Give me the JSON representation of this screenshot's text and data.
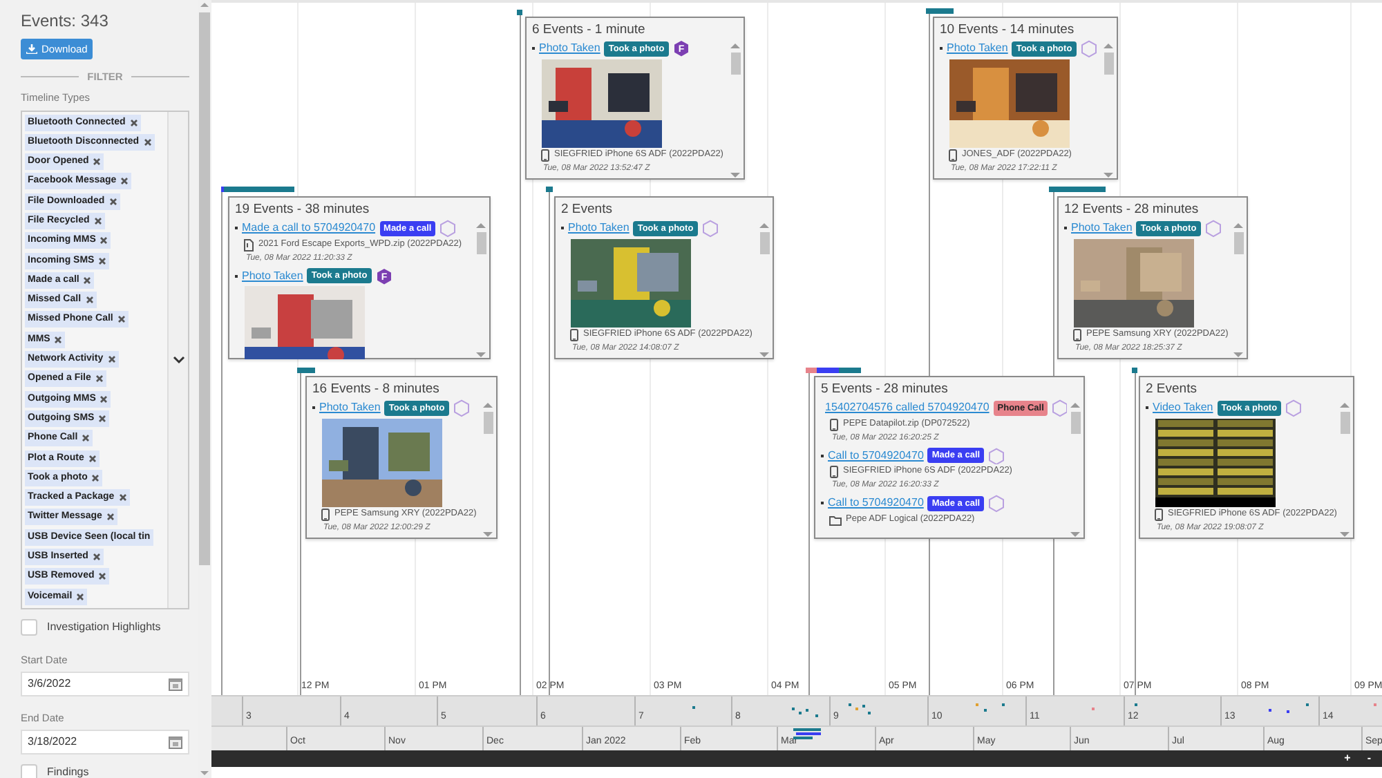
{
  "sidebar": {
    "event_count": "Events: 343",
    "download_button": "Download",
    "filter_heading": "FILTER",
    "timeline_types_label": "Timeline Types",
    "timeline_types": [
      {
        "label": "Bluetooth Connected",
        "removable": true
      },
      {
        "label": "Bluetooth Disconnected",
        "removable": true
      },
      {
        "label": "Door Opened",
        "removable": true
      },
      {
        "label": "Facebook Message",
        "removable": true
      },
      {
        "label": "File Downloaded",
        "removable": true
      },
      {
        "label": "File Recycled",
        "removable": true
      },
      {
        "label": "Incoming MMS",
        "removable": true
      },
      {
        "label": "Incoming SMS",
        "removable": true
      },
      {
        "label": "Made a call",
        "removable": true
      },
      {
        "label": "Missed Call",
        "removable": true
      },
      {
        "label": "Missed Phone Call",
        "removable": true
      },
      {
        "label": "MMS",
        "removable": true
      },
      {
        "label": "Network Activity",
        "removable": true
      },
      {
        "label": "Opened a File",
        "removable": true
      },
      {
        "label": "Outgoing MMS",
        "removable": true
      },
      {
        "label": "Outgoing SMS",
        "removable": true
      },
      {
        "label": "Phone Call",
        "removable": true
      },
      {
        "label": "Plot a Route",
        "removable": true
      },
      {
        "label": "Took a photo",
        "removable": true
      },
      {
        "label": "Tracked a Package",
        "removable": true
      },
      {
        "label": "Twitter Message",
        "removable": true
      },
      {
        "label": "USB Device Seen (local tin",
        "removable": false
      },
      {
        "label": "USB Inserted",
        "removable": true
      },
      {
        "label": "USB Removed",
        "removable": true
      },
      {
        "label": "Voicemail",
        "removable": true
      }
    ],
    "investigation_highlights": {
      "label": "Investigation Highlights",
      "checked": false
    },
    "start_date": {
      "label": "Start Date",
      "value": "3/6/2022"
    },
    "end_date": {
      "label": "End Date",
      "value": "3/18/2022"
    },
    "findings": {
      "label": "Findings",
      "checked": false
    }
  },
  "timeline": {
    "cards": [
      {
        "title": "6 Events - 1 minute",
        "events": [
          {
            "link": "Photo Taken",
            "tag": {
              "label": "Took a photo"
            },
            "flagged": true,
            "flag_label": "F",
            "has_picture": true,
            "device": {
              "label": "SIEGFRIED iPhone 6S ADF (2022PDA22)",
              "kind": "phone"
            },
            "time": "Tue, 08 Mar 2022 13:52:47 Z"
          }
        ]
      },
      {
        "title": "10 Events - 14 minutes",
        "events": [
          {
            "link": "Photo Taken",
            "tag": {
              "label": "Took a photo"
            },
            "flagged": false,
            "has_picture": true,
            "device": {
              "label": "JONES_ADF (2022PDA22)",
              "kind": "phone"
            },
            "time": "Tue, 08 Mar 2022 17:22:11 Z"
          }
        ]
      },
      {
        "title": "19 Events - 38 minutes",
        "events": [
          {
            "link": "Made a call to 5704920470",
            "tag": {
              "label": "Made a call",
              "kind": "call"
            },
            "flagged": false,
            "has_picture": false,
            "device": {
              "label": "2021 Ford Escape Exports_WPD.zip (2022PDA22)",
              "kind": "file"
            },
            "time": "Tue, 08 Mar 2022 11:20:33 Z"
          },
          {
            "link": "Photo Taken",
            "tag": {
              "label": "Took a photo"
            },
            "flagged": true,
            "flag_label": "F",
            "has_picture": true
          }
        ]
      },
      {
        "title": "2 Events",
        "events": [
          {
            "link": "Photo Taken",
            "tag": {
              "label": "Took a photo"
            },
            "flagged": false,
            "has_picture": true,
            "device": {
              "label": "SIEGFRIED iPhone 6S ADF (2022PDA22)",
              "kind": "phone"
            },
            "time": "Tue, 08 Mar 2022 14:08:07 Z"
          }
        ]
      },
      {
        "title": "12 Events - 28 minutes",
        "events": [
          {
            "link": "Photo Taken",
            "tag": {
              "label": "Took a photo"
            },
            "flagged": false,
            "has_picture": true,
            "device": {
              "label": "PEPE Samsung XRY (2022PDA22)",
              "kind": "phone"
            },
            "time": "Tue, 08 Mar 2022 18:25:37 Z"
          }
        ]
      },
      {
        "title": "16 Events - 8 minutes",
        "events": [
          {
            "link": "Photo Taken",
            "tag": {
              "label": "Took a photo"
            },
            "flagged": false,
            "has_picture": true,
            "device": {
              "label": "PEPE Samsung XRY (2022PDA22)",
              "kind": "phone"
            },
            "time": "Tue, 08 Mar 2022 12:00:29 Z"
          }
        ]
      },
      {
        "title": "5 Events - 28 minutes",
        "events": [
          {
            "link": "15402704576 called 5704920470",
            "tag": {
              "label": "Phone Call",
              "kind": "phone-call"
            },
            "flagged": false,
            "has_picture": false,
            "device": {
              "label": "PEPE Datapilot.zip (DP072522)",
              "kind": "phone"
            },
            "time": "Tue, 08 Mar 2022 16:20:25 Z"
          },
          {
            "link": "Call to 5704920470",
            "tag": {
              "label": "Made a call",
              "kind": "call"
            },
            "flagged": false,
            "has_picture": false,
            "device": {
              "label": "SIEGFRIED iPhone 6S ADF (2022PDA22)",
              "kind": "phone"
            },
            "time": "Tue, 08 Mar 2022 16:20:33 Z"
          },
          {
            "link": "Call to 5704920470",
            "tag": {
              "label": "Made a call",
              "kind": "call"
            },
            "flagged": false,
            "has_picture": false,
            "device": {
              "label": "Pepe ADF Logical (2022PDA22)",
              "kind": "folder"
            }
          }
        ]
      },
      {
        "title": "2 Events",
        "events": [
          {
            "link": "Video Taken",
            "tag": {
              "label": "Took a photo"
            },
            "flagged": false,
            "has_picture": true,
            "device": {
              "label": "SIEGFRIED iPhone 6S ADF (2022PDA22)",
              "kind": "phone"
            },
            "time": "Tue, 08 Mar 2022 19:08:07 Z"
          }
        ]
      }
    ],
    "hour_labels": [
      "12 PM",
      "01 PM",
      "02 PM",
      "03 PM",
      "04 PM",
      "05 PM",
      "06 PM",
      "07 PM",
      "08 PM",
      "09 PM"
    ],
    "day_labels": [
      "3",
      "4",
      "5",
      "6",
      "7",
      "8",
      "9",
      "10",
      "11",
      "12",
      "13",
      "14"
    ],
    "month_labels": [
      "Oct",
      "Nov",
      "Dec",
      "Jan 2022",
      "Feb",
      "Mar",
      "Apr",
      "May",
      "Jun",
      "Jul",
      "Aug",
      "Sep"
    ],
    "zoom_in": "+",
    "zoom_out": "-"
  }
}
